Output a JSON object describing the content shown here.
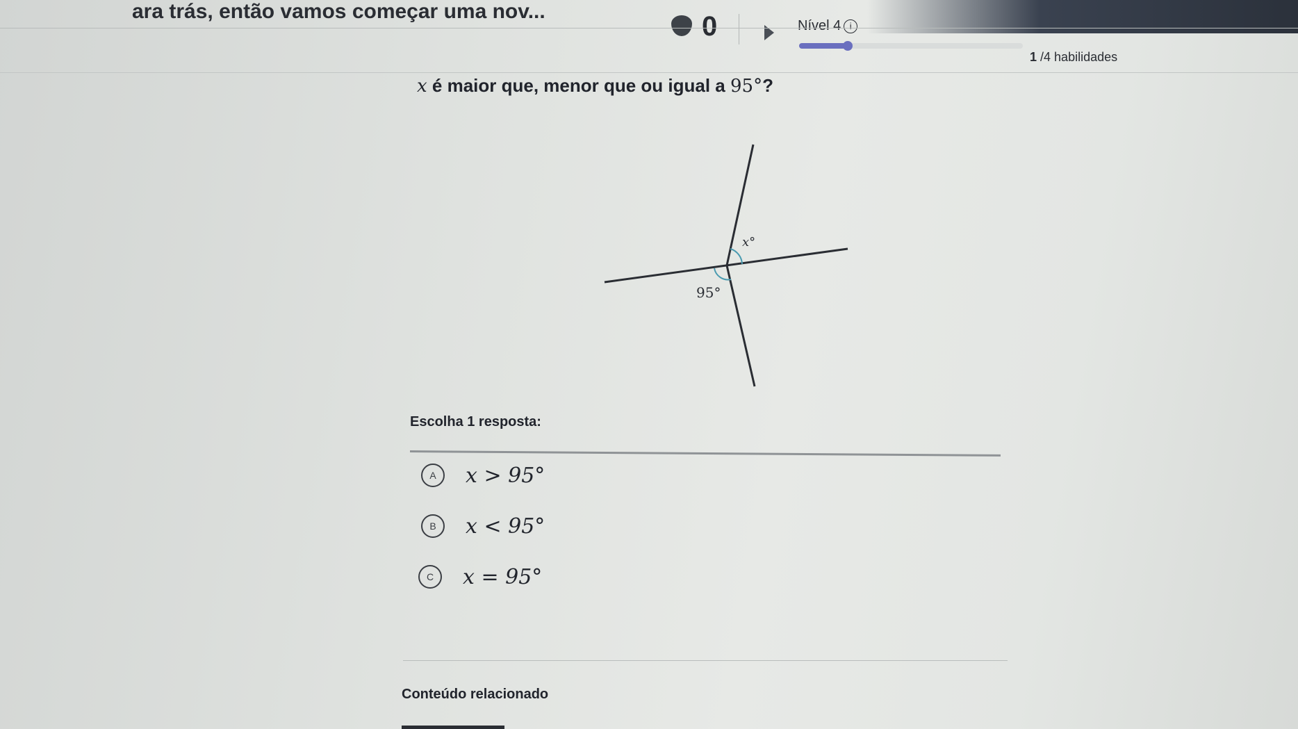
{
  "header": {
    "task_title": "ara trás, então vamos começar uma nov...",
    "streak_count": "0",
    "level_label": "Nível 4",
    "info_symbol": "i",
    "level_progress": 0.22,
    "skills_done": "1",
    "skills_total": "/4 habilidades"
  },
  "question": {
    "var": "x",
    "text": " é maior que, menor que ou igual a ",
    "value": "95°",
    "end": "?"
  },
  "figure": {
    "angle_x_label": "x°",
    "angle_95_label": "95°"
  },
  "choices": {
    "prompt": "Escolha 1 resposta:",
    "items": [
      {
        "letter": "A",
        "text": "x > 95°"
      },
      {
        "letter": "B",
        "text": "x < 95°"
      },
      {
        "letter": "C",
        "text": "x = 95°"
      }
    ]
  },
  "footer": {
    "related": "Conteúdo relacionado"
  },
  "colors": {
    "progress": "#6a6fbf",
    "text": "#21242c",
    "angle_mark": "#4a9bb0"
  },
  "icons": [
    "streak-flame-icon",
    "play-icon",
    "info-icon"
  ]
}
